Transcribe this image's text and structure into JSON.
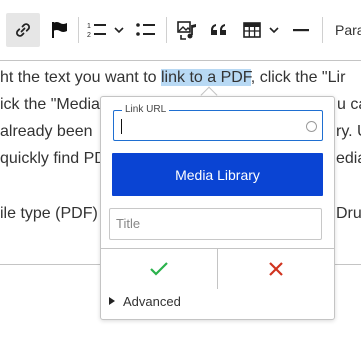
{
  "toolbar": {
    "link_icon": "link-icon",
    "flag_icon": "flag-icon",
    "numbered_list_icon": "numbered-list-icon",
    "bulleted_list_icon": "bulleted-list-icon",
    "media_icon": "media-icon",
    "quote_icon": "blockquote-icon",
    "table_icon": "table-icon",
    "hr_icon": "horizontal-line-icon",
    "paragraph_label": "Para"
  },
  "content": {
    "line1_before": "ht the text you want to ",
    "line1_highlight": "link to a PDF",
    "line1_after": ", click the \"Lir",
    "line2_a": "ick the \"Media",
    "line2_b": "u ca",
    "line3_a": "already been",
    "line3_b": "ry. U",
    "line4_a": "quickly find PD",
    "line4_b": "edia",
    "line5_a": "ile type (PDF)",
    "line5_b": "Drup"
  },
  "balloon": {
    "url_label": "Link URL",
    "url_value": "",
    "media_library_label": "Media Library",
    "title_placeholder": "Title",
    "advanced_label": "Advanced"
  },
  "colors": {
    "accent": "#0a44d3",
    "highlight": "#b8d9f4",
    "confirm": "#2bb24c",
    "cancel": "#d0341f"
  }
}
